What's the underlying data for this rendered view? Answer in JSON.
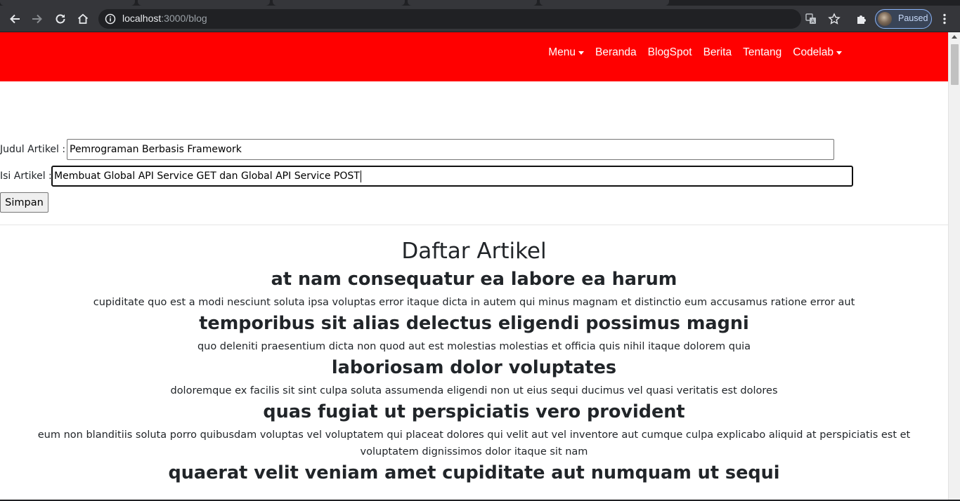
{
  "browser": {
    "url_host": "localhost",
    "url_path": ":3000/blog",
    "profile_label": "Paused"
  },
  "navbar": {
    "bg_color": "#ff0000",
    "items": [
      {
        "label": "Menu",
        "dropdown": true
      },
      {
        "label": "Beranda",
        "dropdown": false
      },
      {
        "label": "BlogSpot",
        "dropdown": false
      },
      {
        "label": "Berita",
        "dropdown": false
      },
      {
        "label": "Tentang",
        "dropdown": false
      },
      {
        "label": "Codelab",
        "dropdown": true
      }
    ]
  },
  "form": {
    "title_label": "Judul Artikel :",
    "title_value": "Pemrograman Berbasis Framework",
    "body_label": "Isi Artikel :",
    "body_value": "Membuat Global API Service GET dan Global API Service POST",
    "submit_label": "Simpan"
  },
  "articles": {
    "heading": "Daftar Artikel",
    "items": [
      {
        "title": "at nam consequatur ea labore ea harum",
        "body": "cupiditate quo est a modi nesciunt soluta ipsa voluptas error itaque dicta in autem qui minus magnam et distinctio eum accusamus ratione error aut"
      },
      {
        "title": "temporibus sit alias delectus eligendi possimus magni",
        "body": "quo deleniti praesentium dicta non quod aut est molestias molestias et officia quis nihil itaque dolorem quia"
      },
      {
        "title": "laboriosam dolor voluptates",
        "body": "doloremque ex facilis sit sint culpa soluta assumenda eligendi non ut eius sequi ducimus vel quasi veritatis est dolores"
      },
      {
        "title": "quas fugiat ut perspiciatis vero provident",
        "body": "eum non blanditiis soluta porro quibusdam voluptas vel voluptatem qui placeat dolores qui velit aut vel inventore aut cumque culpa explicabo aliquid at perspiciatis est et voluptatem dignissimos dolor itaque sit nam"
      },
      {
        "title": "quaerat velit veniam amet cupiditate aut numquam ut sequi",
        "body": ""
      }
    ]
  }
}
